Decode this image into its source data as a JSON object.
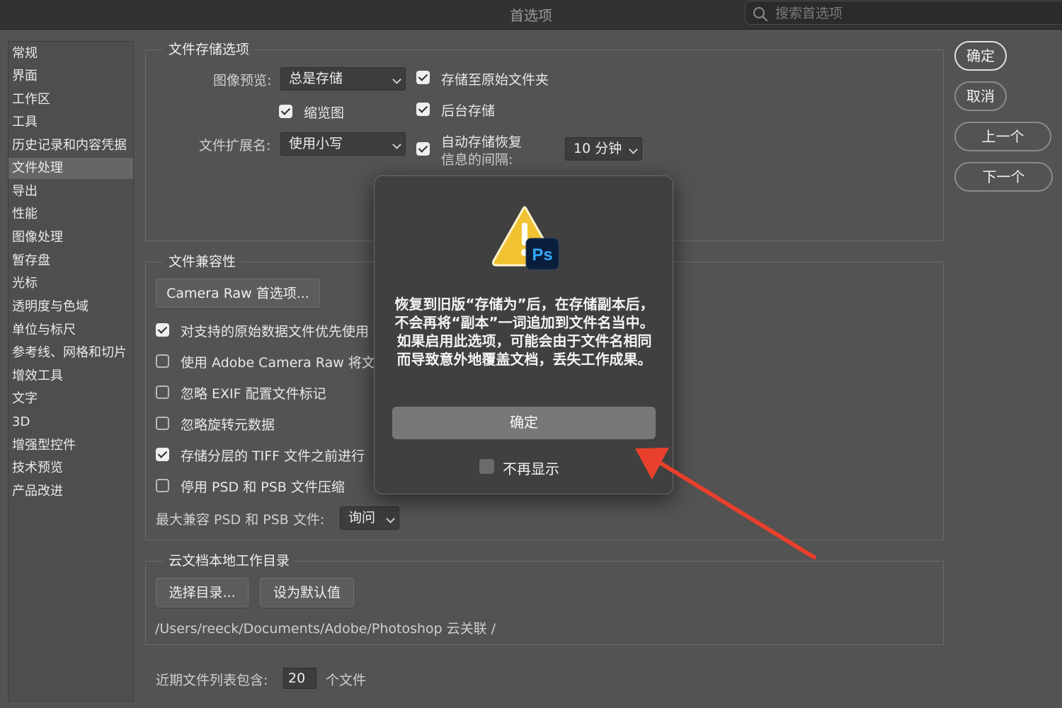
{
  "window": {
    "title": "首选项",
    "search_placeholder": "搜索首选项"
  },
  "sidebar": {
    "items": [
      {
        "label": "常规"
      },
      {
        "label": "界面"
      },
      {
        "label": "工作区"
      },
      {
        "label": "工具"
      },
      {
        "label": "历史记录和内容凭据"
      },
      {
        "label": "文件处理",
        "active": true
      },
      {
        "label": "导出"
      },
      {
        "label": "性能"
      },
      {
        "label": "图像处理"
      },
      {
        "label": "暂存盘"
      },
      {
        "label": "光标"
      },
      {
        "label": "透明度与色域"
      },
      {
        "label": "单位与标尺"
      },
      {
        "label": "参考线、网格和切片"
      },
      {
        "label": "增效工具"
      },
      {
        "label": "文字"
      },
      {
        "label": "3D"
      },
      {
        "label": "增强型控件"
      },
      {
        "label": "技术预览"
      },
      {
        "label": "产品改进"
      }
    ]
  },
  "file_saving": {
    "legend": "文件存储选项",
    "image_preview_label": "图像预览:",
    "image_preview_value": "总是存储",
    "thumbnail_label": "缩览图",
    "thumbnail_checked": true,
    "extension_label": "文件扩展名:",
    "extension_value": "使用小写",
    "save_to_original_label": "存储至原始文件夹",
    "save_to_original_checked": true,
    "background_save_label": "后台存储",
    "background_save_checked": true,
    "autosave_line1": "自动存储恢复",
    "autosave_line2": "信息的间隔:",
    "autosave_checked": true,
    "autosave_interval": "10 分钟"
  },
  "compatibility": {
    "legend": "文件兼容性",
    "camera_raw_button": "Camera Raw 首选项...",
    "options": [
      {
        "label": "对支持的原始数据文件优先使用",
        "checked": true
      },
      {
        "label": "使用 Adobe Camera Raw 将文",
        "checked": false
      },
      {
        "label": "忽略 EXIF 配置文件标记",
        "checked": false
      },
      {
        "label": "忽略旋转元数据",
        "checked": false
      },
      {
        "label": "存储分层的 TIFF 文件之前进行",
        "checked": true
      },
      {
        "label": "停用 PSD 和 PSB 文件压缩",
        "checked": false
      }
    ],
    "max_compat_label": "最大兼容 PSD 和 PSB 文件:",
    "max_compat_value": "询问"
  },
  "cloud": {
    "legend": "云文档本地工作目录",
    "choose_dir_button": "选择目录...",
    "set_default_button": "设为默认值",
    "path": "/Users/reeck/Documents/Adobe/Photoshop 云关联 /"
  },
  "recent": {
    "label": "近期文件列表包含:",
    "value": "20",
    "suffix": "个文件"
  },
  "actions": {
    "ok": "确定",
    "cancel": "取消",
    "prev": "上一个",
    "next": "下一个"
  },
  "dialog": {
    "app_badge": "Ps",
    "message": "恢复到旧版“存储为”后，在存储副本后，不会再将“副本”一词追加到文件名当中。如果启用此选项，可能会由于文件名相同而导致意外地覆盖文档，丢失工作成果。",
    "ok_button": "确定",
    "dont_show_label": "不再显示",
    "dont_show_checked": false
  },
  "colors": {
    "background": "#535353",
    "dialog_bg": "#404040",
    "annotation_arrow": "#e8402c",
    "ps_badge": "#0a1d3a",
    "ps_text": "#31a8ff"
  }
}
